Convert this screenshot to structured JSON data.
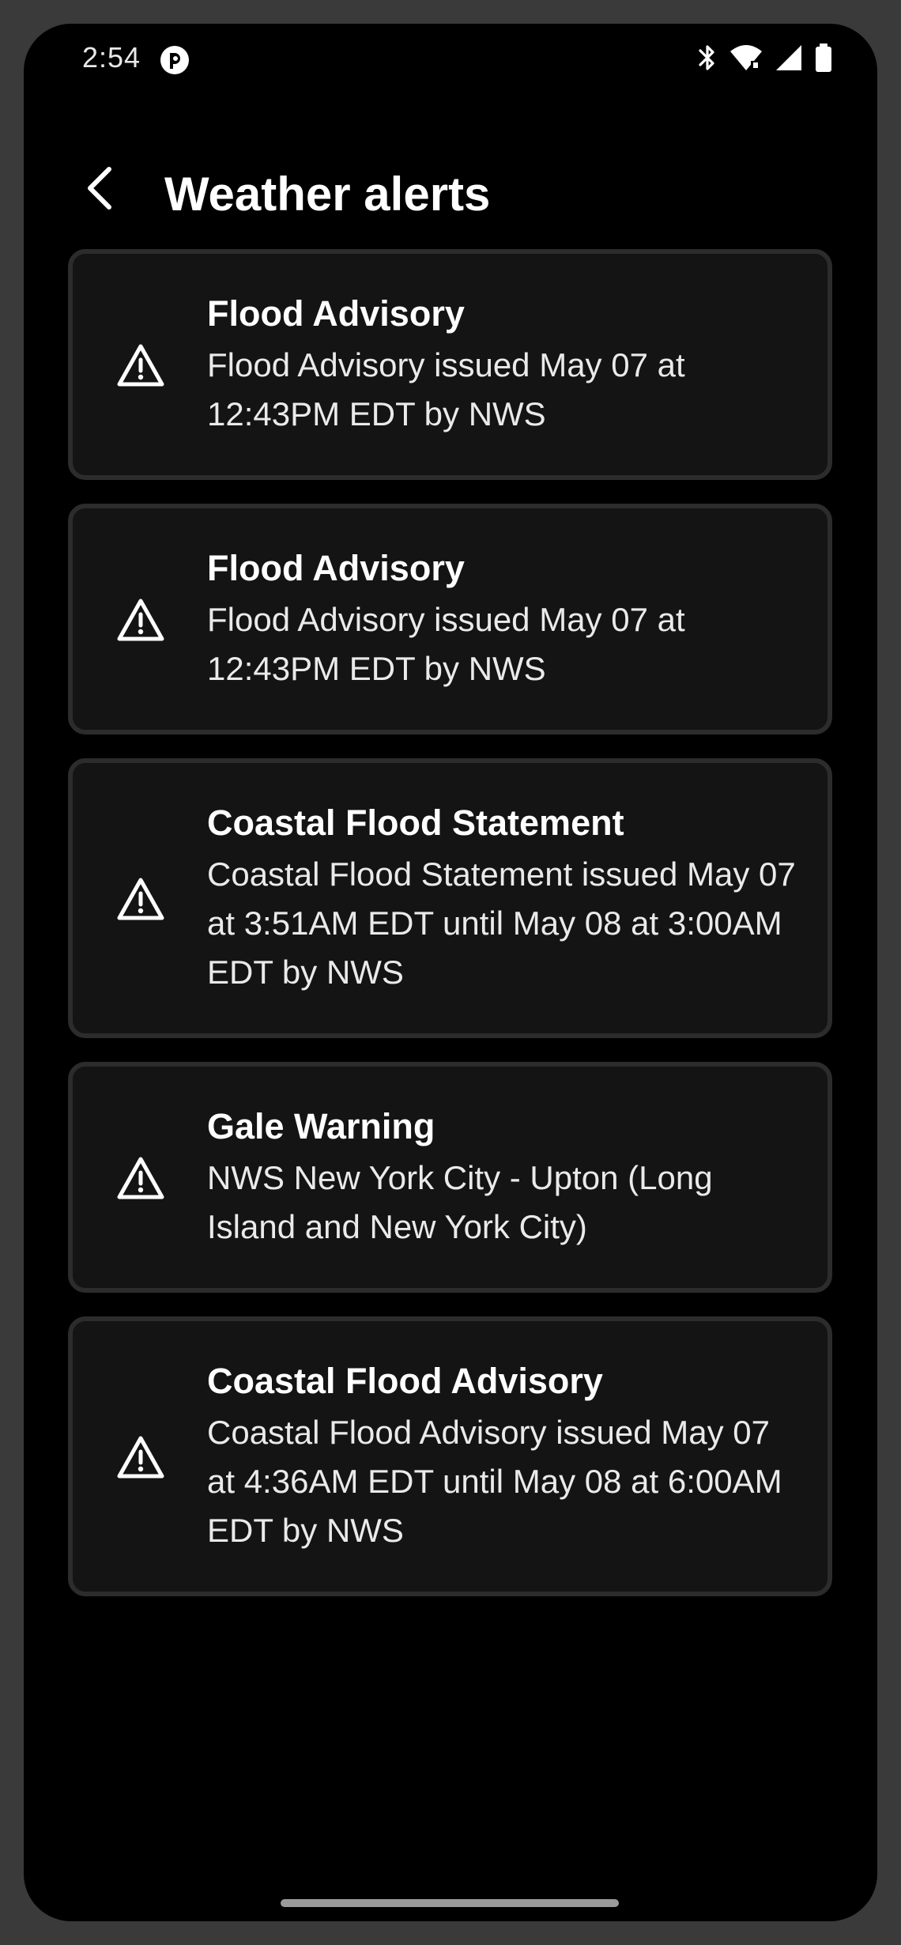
{
  "status_bar": {
    "time": "2:54",
    "icons": [
      "app-notification-icon",
      "bluetooth-icon",
      "wifi-icon",
      "cellular-signal-icon",
      "battery-icon"
    ]
  },
  "app_bar": {
    "title": "Weather alerts",
    "back_icon": "back-arrow-icon"
  },
  "alerts": [
    {
      "title": "Flood Advisory",
      "description": "Flood Advisory issued May 07 at 12:43PM EDT by NWS",
      "icon": "warning-triangle-icon"
    },
    {
      "title": "Flood Advisory",
      "description": "Flood Advisory issued May 07 at 12:43PM EDT by NWS",
      "icon": "warning-triangle-icon"
    },
    {
      "title": "Coastal Flood Statement",
      "description": "Coastal Flood Statement issued May 07 at 3:51AM EDT until May 08 at 3:00AM EDT by NWS",
      "icon": "warning-triangle-icon"
    },
    {
      "title": "Gale Warning",
      "description": "NWS New York City - Upton (Long Island and New York City)",
      "icon": "warning-triangle-icon"
    },
    {
      "title": "Coastal Flood Advisory",
      "description": "Coastal Flood Advisory issued May 07 at 4:36AM EDT until May 08 at 6:00AM EDT by NWS",
      "icon": "warning-triangle-icon"
    }
  ],
  "colors": {
    "background": "#000000",
    "card_background": "#141414",
    "card_border": "#2c2c2c",
    "text_primary": "#ffffff",
    "bezel": "#3a3a3a"
  }
}
